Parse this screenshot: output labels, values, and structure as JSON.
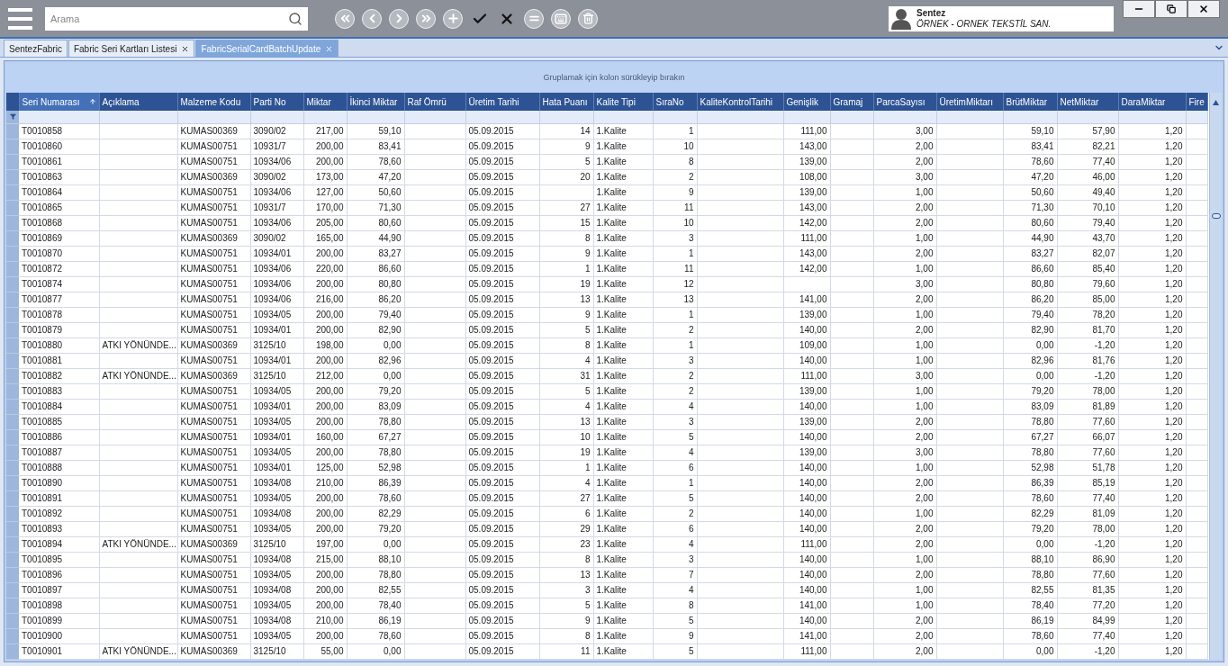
{
  "search": {
    "placeholder": "Arama"
  },
  "user": {
    "name": "Sentez",
    "company": "ÖRNEK - ORNEK TEKSTİL SAN."
  },
  "tabs": [
    {
      "label": "SentezFabric",
      "selected": false,
      "closable": false
    },
    {
      "label": "Fabric Seri Kartları Listesi",
      "selected": false,
      "closable": true
    },
    {
      "label": "FabricSerialCardBatchUpdate",
      "selected": true,
      "closable": true
    }
  ],
  "group_panel": "Gruplamak için kolon sürükleyip bırakın",
  "columns": [
    {
      "label": "Seri Numarası",
      "sorted": true
    },
    {
      "label": "Açıklama",
      "sorted": false
    },
    {
      "label": "Malzeme Kodu",
      "sorted": false
    },
    {
      "label": "Parti No",
      "sorted": false
    },
    {
      "label": "Miktar",
      "sorted": false
    },
    {
      "label": "İkinci Miktar",
      "sorted": false
    },
    {
      "label": "Raf Ömrü",
      "sorted": false
    },
    {
      "label": "Üretim Tarihi",
      "sorted": false
    },
    {
      "label": "Hata Puanı",
      "sorted": false
    },
    {
      "label": "Kalite Tipi",
      "sorted": false
    },
    {
      "label": "SıraNo",
      "sorted": false
    },
    {
      "label": "KaliteKontrolTarihi",
      "sorted": false
    },
    {
      "label": "Genişlik",
      "sorted": false
    },
    {
      "label": "Gramaj",
      "sorted": false
    },
    {
      "label": "ParcaSayısı",
      "sorted": false
    },
    {
      "label": "ÜretimMiktarı",
      "sorted": false
    },
    {
      "label": "BrütMiktar",
      "sorted": false
    },
    {
      "label": "NetMiktar",
      "sorted": false
    },
    {
      "label": "DaraMiktar",
      "sorted": false
    },
    {
      "label": "Fire",
      "sorted": false
    }
  ],
  "rows": [
    [
      "T0010858",
      null,
      "KUMAS00369",
      "3090/02",
      "217,00",
      "59,10",
      null,
      "05.09.2015",
      "14",
      "1.Kalite",
      "1",
      null,
      "111,00",
      null,
      "3,00",
      null,
      "59,10",
      "57,90",
      "1,20",
      null
    ],
    [
      "T0010860",
      null,
      "KUMAS00751",
      "10931/7",
      "200,00",
      "83,41",
      null,
      "05.09.2015",
      "9",
      "1.Kalite",
      "10",
      null,
      "143,00",
      null,
      "2,00",
      null,
      "83,41",
      "82,21",
      "1,20",
      null
    ],
    [
      "T0010861",
      null,
      "KUMAS00751",
      "10934/06",
      "200,00",
      "78,60",
      null,
      "05.09.2015",
      "5",
      "1.Kalite",
      "8",
      null,
      "139,00",
      null,
      "2,00",
      null,
      "78,60",
      "77,40",
      "1,20",
      null
    ],
    [
      "T0010863",
      null,
      "KUMAS00369",
      "3090/02",
      "173,00",
      "47,20",
      null,
      "05.09.2015",
      "20",
      "1.Kalite",
      "2",
      null,
      "108,00",
      null,
      "3,00",
      null,
      "47,20",
      "46,00",
      "1,20",
      null
    ],
    [
      "T0010864",
      null,
      "KUMAS00751",
      "10934/06",
      "127,00",
      "50,60",
      null,
      "05.09.2015",
      null,
      "1.Kalite",
      "9",
      null,
      "139,00",
      null,
      "1,00",
      null,
      "50,60",
      "49,40",
      "1,20",
      null
    ],
    [
      "T0010865",
      null,
      "KUMAS00751",
      "10931/7",
      "170,00",
      "71,30",
      null,
      "05.09.2015",
      "27",
      "1.Kalite",
      "11",
      null,
      "143,00",
      null,
      "2,00",
      null,
      "71,30",
      "70,10",
      "1,20",
      null
    ],
    [
      "T0010868",
      null,
      "KUMAS00751",
      "10934/06",
      "205,00",
      "80,60",
      null,
      "05.09.2015",
      "15",
      "1.Kalite",
      "10",
      null,
      "142,00",
      null,
      "2,00",
      null,
      "80,60",
      "79,40",
      "1,20",
      null
    ],
    [
      "T0010869",
      null,
      "KUMAS00369",
      "3090/02",
      "165,00",
      "44,90",
      null,
      "05.09.2015",
      "8",
      "1.Kalite",
      "3",
      null,
      "111,00",
      null,
      "1,00",
      null,
      "44,90",
      "43,70",
      "1,20",
      null
    ],
    [
      "T0010870",
      null,
      "KUMAS00751",
      "10934/01",
      "200,00",
      "83,27",
      null,
      "05.09.2015",
      "9",
      "1.Kalite",
      "1",
      null,
      "143,00",
      null,
      "2,00",
      null,
      "83,27",
      "82,07",
      "1,20",
      null
    ],
    [
      "T0010872",
      null,
      "KUMAS00751",
      "10934/06",
      "220,00",
      "86,60",
      null,
      "05.09.2015",
      "1",
      "1.Kalite",
      "11",
      null,
      "142,00",
      null,
      "1,00",
      null,
      "86,60",
      "85,40",
      "1,20",
      null
    ],
    [
      "T0010874",
      null,
      "KUMAS00751",
      "10934/06",
      "200,00",
      "80,80",
      null,
      "05.09.2015",
      "19",
      "1.Kalite",
      "12",
      null,
      null,
      null,
      "3,00",
      null,
      "80,80",
      "79,60",
      "1,20",
      null
    ],
    [
      "T0010877",
      null,
      "KUMAS00751",
      "10934/06",
      "216,00",
      "86,20",
      null,
      "05.09.2015",
      "13",
      "1.Kalite",
      "13",
      null,
      "141,00",
      null,
      "2,00",
      null,
      "86,20",
      "85,00",
      "1,20",
      null
    ],
    [
      "T0010878",
      null,
      "KUMAS00751",
      "10934/05",
      "200,00",
      "79,40",
      null,
      "05.09.2015",
      "9",
      "1.Kalite",
      "1",
      null,
      "139,00",
      null,
      "1,00",
      null,
      "79,40",
      "78,20",
      "1,20",
      null
    ],
    [
      "T0010879",
      null,
      "KUMAS00751",
      "10934/01",
      "200,00",
      "82,90",
      null,
      "05.09.2015",
      "5",
      "1.Kalite",
      "2",
      null,
      "140,00",
      null,
      "2,00",
      null,
      "82,90",
      "81,70",
      "1,20",
      null
    ],
    [
      "T0010880",
      "ATKI YÖNÜNDE...",
      "KUMAS00369",
      "3125/10",
      "198,00",
      "0,00",
      null,
      "05.09.2015",
      "8",
      "1.Kalite",
      "1",
      null,
      "109,00",
      null,
      "1,00",
      null,
      "0,00",
      "-1,20",
      "1,20",
      null
    ],
    [
      "T0010881",
      null,
      "KUMAS00751",
      "10934/01",
      "200,00",
      "82,96",
      null,
      "05.09.2015",
      "4",
      "1.Kalite",
      "3",
      null,
      "140,00",
      null,
      "1,00",
      null,
      "82,96",
      "81,76",
      "1,20",
      null
    ],
    [
      "T0010882",
      "ATKI YÖNÜNDE...",
      "KUMAS00369",
      "3125/10",
      "212,00",
      "0,00",
      null,
      "05.09.2015",
      "31",
      "1.Kalite",
      "2",
      null,
      "111,00",
      null,
      "3,00",
      null,
      "0,00",
      "-1,20",
      "1,20",
      null
    ],
    [
      "T0010883",
      null,
      "KUMAS00751",
      "10934/05",
      "200,00",
      "79,20",
      null,
      "05.09.2015",
      "5",
      "1.Kalite",
      "2",
      null,
      "139,00",
      null,
      "1,00",
      null,
      "79,20",
      "78,00",
      "1,20",
      null
    ],
    [
      "T0010884",
      null,
      "KUMAS00751",
      "10934/01",
      "200,00",
      "83,09",
      null,
      "05.09.2015",
      "4",
      "1.Kalite",
      "4",
      null,
      "140,00",
      null,
      "1,00",
      null,
      "83,09",
      "81,89",
      "1,20",
      null
    ],
    [
      "T0010885",
      null,
      "KUMAS00751",
      "10934/05",
      "200,00",
      "78,80",
      null,
      "05.09.2015",
      "13",
      "1.Kalite",
      "3",
      null,
      "139,00",
      null,
      "2,00",
      null,
      "78,80",
      "77,60",
      "1,20",
      null
    ],
    [
      "T0010886",
      null,
      "KUMAS00751",
      "10934/01",
      "160,00",
      "67,27",
      null,
      "05.09.2015",
      "10",
      "1.Kalite",
      "5",
      null,
      "140,00",
      null,
      "2,00",
      null,
      "67,27",
      "66,07",
      "1,20",
      null
    ],
    [
      "T0010887",
      null,
      "KUMAS00751",
      "10934/05",
      "200,00",
      "78,80",
      null,
      "05.09.2015",
      "19",
      "1.Kalite",
      "4",
      null,
      "139,00",
      null,
      "3,00",
      null,
      "78,80",
      "77,60",
      "1,20",
      null
    ],
    [
      "T0010888",
      null,
      "KUMAS00751",
      "10934/01",
      "125,00",
      "52,98",
      null,
      "05.09.2015",
      "1",
      "1.Kalite",
      "6",
      null,
      "140,00",
      null,
      "1,00",
      null,
      "52,98",
      "51,78",
      "1,20",
      null
    ],
    [
      "T0010890",
      null,
      "KUMAS00751",
      "10934/08",
      "210,00",
      "86,39",
      null,
      "05.09.2015",
      "4",
      "1.Kalite",
      "1",
      null,
      "140,00",
      null,
      "2,00",
      null,
      "86,39",
      "85,19",
      "1,20",
      null
    ],
    [
      "T0010891",
      null,
      "KUMAS00751",
      "10934/05",
      "200,00",
      "78,60",
      null,
      "05.09.2015",
      "27",
      "1.Kalite",
      "5",
      null,
      "140,00",
      null,
      "2,00",
      null,
      "78,60",
      "77,40",
      "1,20",
      null
    ],
    [
      "T0010892",
      null,
      "KUMAS00751",
      "10934/08",
      "200,00",
      "82,29",
      null,
      "05.09.2015",
      "6",
      "1.Kalite",
      "2",
      null,
      "140,00",
      null,
      "1,00",
      null,
      "82,29",
      "81,09",
      "1,20",
      null
    ],
    [
      "T0010893",
      null,
      "KUMAS00751",
      "10934/05",
      "200,00",
      "79,20",
      null,
      "05.09.2015",
      "29",
      "1.Kalite",
      "6",
      null,
      "140,00",
      null,
      "2,00",
      null,
      "79,20",
      "78,00",
      "1,20",
      null
    ],
    [
      "T0010894",
      "ATKI YÖNÜNDE...",
      "KUMAS00369",
      "3125/10",
      "197,00",
      "0,00",
      null,
      "05.09.2015",
      "23",
      "1.Kalite",
      "4",
      null,
      "111,00",
      null,
      "2,00",
      null,
      "0,00",
      "-1,20",
      "1,20",
      null
    ],
    [
      "T0010895",
      null,
      "KUMAS00751",
      "10934/08",
      "215,00",
      "88,10",
      null,
      "05.09.2015",
      "8",
      "1.Kalite",
      "3",
      null,
      "140,00",
      null,
      "1,00",
      null,
      "88,10",
      "86,90",
      "1,20",
      null
    ],
    [
      "T0010896",
      null,
      "KUMAS00751",
      "10934/05",
      "200,00",
      "78,80",
      null,
      "05.09.2015",
      "13",
      "1.Kalite",
      "7",
      null,
      "140,00",
      null,
      "2,00",
      null,
      "78,80",
      "77,60",
      "1,20",
      null
    ],
    [
      "T0010897",
      null,
      "KUMAS00751",
      "10934/08",
      "200,00",
      "82,55",
      null,
      "05.09.2015",
      "3",
      "1.Kalite",
      "4",
      null,
      "140,00",
      null,
      "1,00",
      null,
      "82,55",
      "81,35",
      "1,20",
      null
    ],
    [
      "T0010898",
      null,
      "KUMAS00751",
      "10934/05",
      "200,00",
      "78,40",
      null,
      "05.09.2015",
      "5",
      "1.Kalite",
      "8",
      null,
      "141,00",
      null,
      "1,00",
      null,
      "78,40",
      "77,20",
      "1,20",
      null
    ],
    [
      "T0010899",
      null,
      "KUMAS00751",
      "10934/08",
      "210,00",
      "86,19",
      null,
      "05.09.2015",
      "9",
      "1.Kalite",
      "5",
      null,
      "140,00",
      null,
      "2,00",
      null,
      "86,19",
      "84,99",
      "1,20",
      null
    ],
    [
      "T0010900",
      null,
      "KUMAS00751",
      "10934/05",
      "200,00",
      "78,60",
      null,
      "05.09.2015",
      "8",
      "1.Kalite",
      "9",
      null,
      "141,00",
      null,
      "2,00",
      null,
      "78,60",
      "77,40",
      "1,20",
      null
    ],
    [
      "T0010901",
      "ATKI YÖNÜNDE...",
      "KUMAS00369",
      "3125/10",
      "55,00",
      "0,00",
      null,
      "05.09.2015",
      "11",
      "1.Kalite",
      "5",
      null,
      "111,00",
      null,
      "2,00",
      null,
      "0,00",
      "-1,20",
      "1,20",
      null
    ]
  ]
}
